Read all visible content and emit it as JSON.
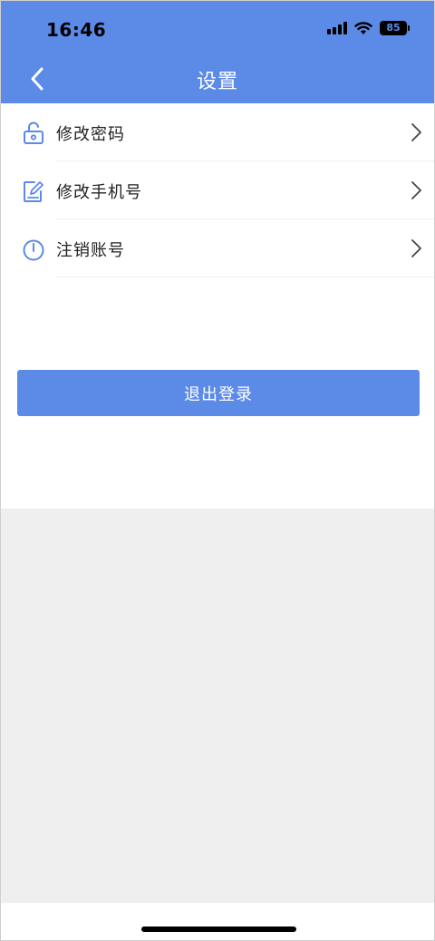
{
  "status_bar": {
    "time": "16:46",
    "battery_level": "85",
    "icons": [
      "signal-icon",
      "wifi-icon",
      "battery-icon"
    ]
  },
  "nav": {
    "title": "设置",
    "back_icon": "chevron-left-icon"
  },
  "menu": {
    "items": [
      {
        "label": "修改密码",
        "icon": "unlock-icon"
      },
      {
        "label": "修改手机号",
        "icon": "edit-icon"
      },
      {
        "label": "注销账号",
        "icon": "power-icon"
      }
    ],
    "chevron_icon": "chevron-right-icon"
  },
  "logout": {
    "label": "退出登录"
  },
  "colors": {
    "accent": "#5b8ae7",
    "background_gray": "#efefef",
    "text": "#222222"
  }
}
